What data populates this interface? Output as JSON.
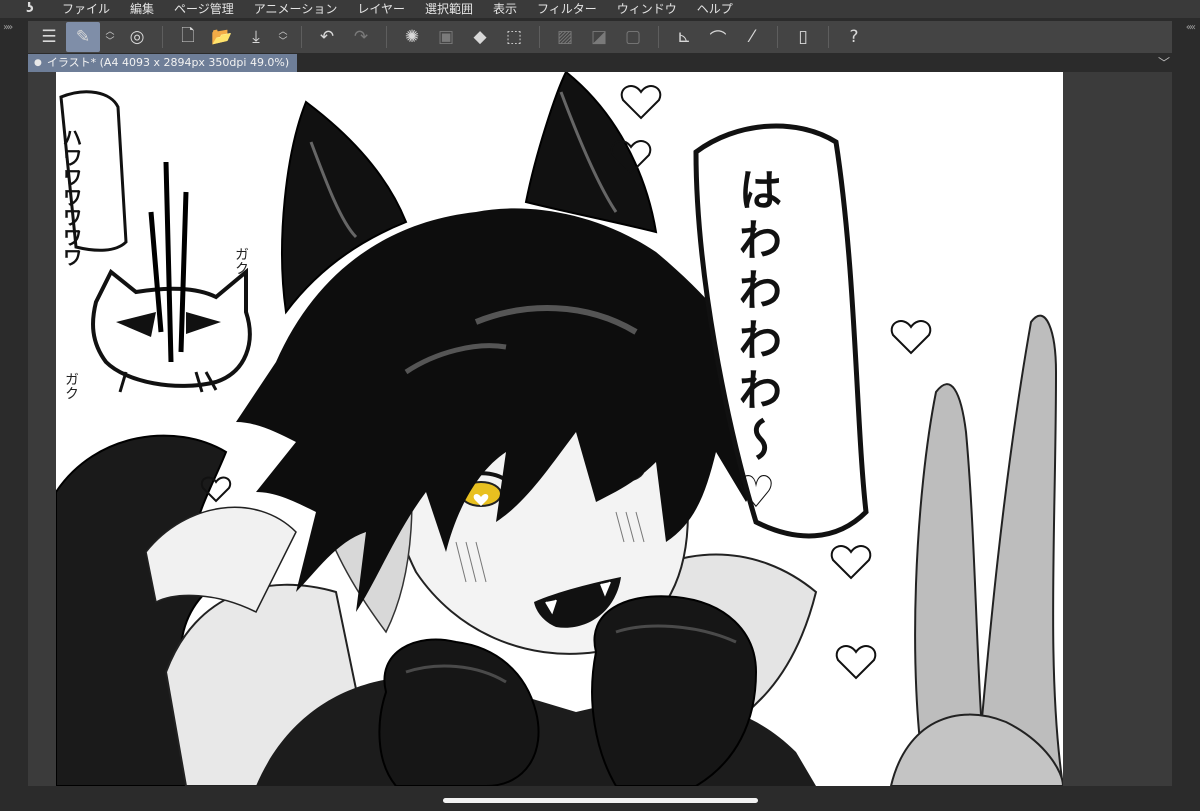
{
  "menu": {
    "items": [
      "ファイル",
      "編集",
      "ページ管理",
      "アニメーション",
      "レイヤー",
      "選択範囲",
      "表示",
      "フィルター",
      "ウィンドウ",
      "ヘルプ"
    ]
  },
  "toolbar": {
    "icons": [
      "menu-icon",
      "brush-edit-icon",
      "spiral-icon",
      "new-page-icon",
      "open-folder-icon",
      "save-tray-icon",
      "undo-icon",
      "redo-icon",
      "loading-icon",
      "selection-fill-icon",
      "paint-bucket-icon",
      "transform-icon",
      "clear-selection-icon",
      "fill-selection-icon",
      "border-icon",
      "ruler-icon",
      "brush-correction-icon",
      "pen-line-icon",
      "smartphone-icon",
      "help-icon"
    ]
  },
  "document": {
    "tab_label": "イラスト* (A4 4093 x 2894px 350dpi 49.0%)"
  },
  "artwork": {
    "speech_text": "はわわわわ〜♡",
    "side_text": "ハワワワワワワ",
    "sfx_top": "ガク",
    "sfx_bottom": "ガク"
  },
  "colors": {
    "menubar": "#3a3a3a",
    "toolbar": "#444444",
    "active_tool": "#7f8ea8",
    "tab": "#6e7e98",
    "canvas_bg": "#3b3b3b",
    "eye": "#e8c020"
  }
}
